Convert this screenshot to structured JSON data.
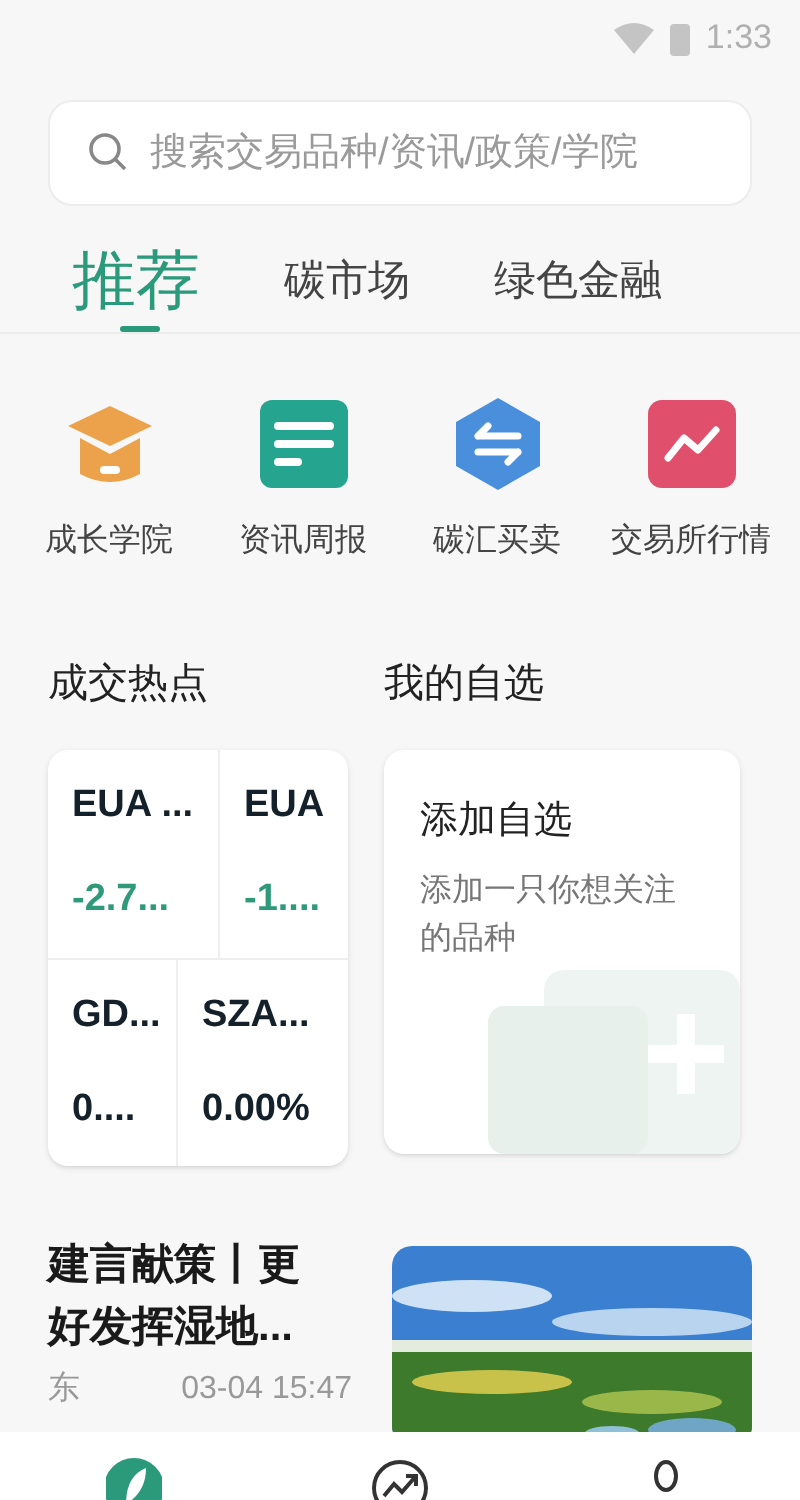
{
  "status_bar": {
    "time": "1:33"
  },
  "search": {
    "placeholder": "搜索交易品种/资讯/政策/学院"
  },
  "tabs": [
    {
      "label": "推荐",
      "selected": true
    },
    {
      "label": "碳市场",
      "selected": false
    },
    {
      "label": "绿色金融",
      "selected": false
    }
  ],
  "shortcuts": [
    {
      "label": "成长学院",
      "kind": "academy"
    },
    {
      "label": "资讯周报",
      "kind": "news"
    },
    {
      "label": "碳汇买卖",
      "kind": "exchange"
    },
    {
      "label": "交易所行情",
      "kind": "market"
    }
  ],
  "hot": {
    "title": "成交热点",
    "rows": [
      [
        {
          "name": "EUA ...",
          "change": "-2.7...",
          "color": "#2e9a7a"
        },
        {
          "name": "EUA",
          "change": "-1....",
          "color": "#2e9a7a"
        }
      ],
      [
        {
          "name": "GD...",
          "change": "0....",
          "color": "#14202a"
        },
        {
          "name": "SZA...",
          "change": "0.00%",
          "color": "#14202a"
        }
      ]
    ]
  },
  "watchlist": {
    "title": "我的自选",
    "card_title": "添加自选",
    "card_text": "添加一只你想关注的品种"
  },
  "article": {
    "title": "建言献策丨更好发挥湿地...",
    "source": "东",
    "time": "03-04 15:47"
  },
  "bottom_nav": [
    {
      "kind": "discover",
      "selected": true
    },
    {
      "kind": "market",
      "selected": false
    },
    {
      "kind": "profile",
      "selected": false
    }
  ]
}
